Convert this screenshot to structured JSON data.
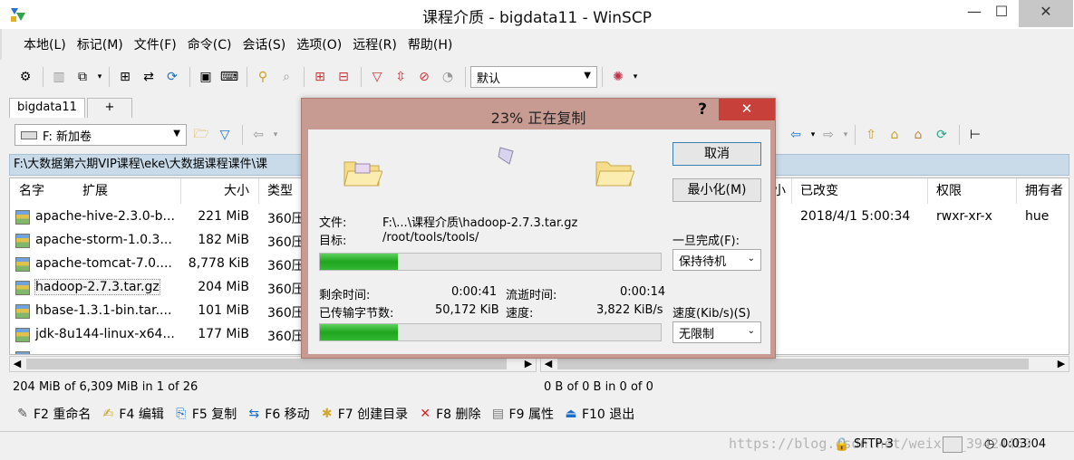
{
  "window": {
    "title": "课程介质 - bigdata11 - WinSCP",
    "minimize": "—",
    "maximize": "☐",
    "close": "✕"
  },
  "menu": [
    "本地(L)",
    "标记(M)",
    "文件(F)",
    "命令(C)",
    "会话(S)",
    "选项(O)",
    "远程(R)",
    "帮助(H)"
  ],
  "toolbar": {
    "profile_select": "默认"
  },
  "tabs": {
    "session": "bigdata11",
    "add": "+"
  },
  "local": {
    "drive": "F: 新加卷",
    "path": "F:\\大数据第六期VIP课程\\eke\\大数据课程课件\\课",
    "columns": [
      "名字",
      "扩展",
      "大小",
      "类型"
    ],
    "files": [
      {
        "name": "apache-hive-2.3.0-b...",
        "size": "221 MiB",
        "type": "360压"
      },
      {
        "name": "apache-storm-1.0.3...",
        "size": "182 MiB",
        "type": "360压"
      },
      {
        "name": "apache-tomcat-7.0....",
        "size": "8,778 KiB",
        "type": "360压"
      },
      {
        "name": "hadoop-2.7.3.tar.gz",
        "size": "204 MiB",
        "type": "360压"
      },
      {
        "name": "hbase-1.3.1-bin.tar....",
        "size": "101 MiB",
        "type": "360压"
      },
      {
        "name": "jdk-8u144-linux-x64...",
        "size": "177 MiB",
        "type": "360压"
      },
      {
        "name": "",
        "size": "",
        "type": ""
      }
    ],
    "status": "204 MiB of 6,309 MiB in 1 of 26"
  },
  "remote": {
    "columns": [
      "小",
      "已改变",
      "权限",
      "拥有者"
    ],
    "files": [
      {
        "changed": "2018/4/1 5:00:34",
        "rights": "rwxr-xr-x",
        "owner": "hue"
      }
    ],
    "status": "0 B of 0 B in 0 of 0"
  },
  "fkeys": [
    {
      "icon": "rename-icon",
      "glyph": "✎",
      "label": "F2 重命名"
    },
    {
      "icon": "edit-icon",
      "glyph": "📝",
      "label": "F4 编辑"
    },
    {
      "icon": "copy-icon",
      "glyph": "⎘",
      "label": "F5 复制"
    },
    {
      "icon": "move-icon",
      "glyph": "⇆",
      "label": "F6 移动"
    },
    {
      "icon": "new-folder-icon",
      "glyph": "✱",
      "label": "F7 创建目录"
    },
    {
      "icon": "delete-icon",
      "glyph": "✕",
      "label": "F8 删除"
    },
    {
      "icon": "properties-icon",
      "glyph": "▤",
      "label": "F9 属性"
    },
    {
      "icon": "quit-icon",
      "glyph": "⏏",
      "label": "F10 退出"
    }
  ],
  "statusbar": {
    "watermark": "https://blog.csdn.net/weixin_39424469",
    "protocol": "SFTP-3",
    "elapsed": "0:03:04"
  },
  "dialog": {
    "title": "23% 正在复制",
    "help": "?",
    "close": "✕",
    "file_label": "文件:",
    "file_value": "F:\\...\\课程介质\\hadoop-2.7.3.tar.gz",
    "target_label": "目标:",
    "target_value": "/root/tools/tools/",
    "file_progress": 0.23,
    "remaining_label": "剩余时间:",
    "remaining_value": "0:00:41",
    "elapsed_label": "流逝时间:",
    "elapsed_value": "0:00:14",
    "transferred_label": "已传输字节数:",
    "transferred_value": "50,172 KiB",
    "speed_label": "速度:",
    "speed_value": "3,822 KiB/s",
    "total_progress": 0.23,
    "cancel_button": "取消",
    "minimize_button": "最小化(M)",
    "on_complete_label": "一旦完成(F):",
    "on_complete_value": "保持待机",
    "speed_limit_label": "速度(Kib/s)(S)",
    "speed_limit_value": "无限制",
    "colors": {
      "progress": "#2db52d",
      "frame": "#c79b92",
      "close": "#c8403a"
    }
  }
}
